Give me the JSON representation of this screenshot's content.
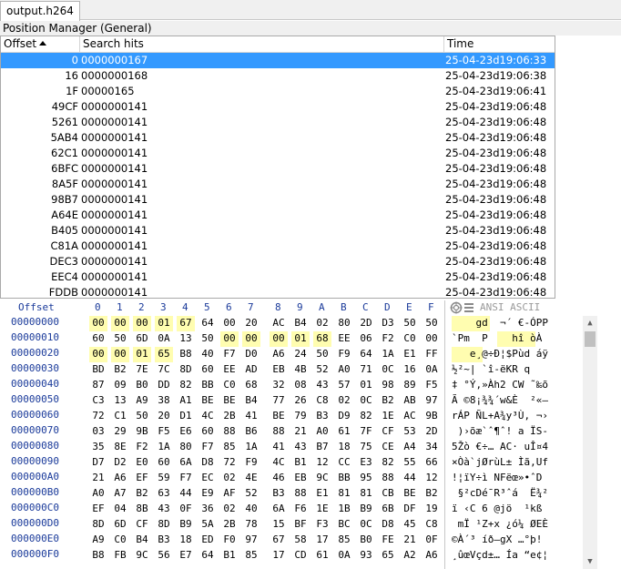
{
  "tab": {
    "label": "output.h264"
  },
  "panel": {
    "title": "Position Manager (General)"
  },
  "list": {
    "columns": {
      "offset": "Offset",
      "hits": "Search hits",
      "time": "Time"
    },
    "rows": [
      {
        "offset": "0",
        "hits": "0000000167",
        "time": "25-04-23d19:06:33",
        "selected": true
      },
      {
        "offset": "16",
        "hits": "0000000168",
        "time": "25-04-23d19:06:38"
      },
      {
        "offset": "1F",
        "hits": "00000165",
        "time": "25-04-23d19:06:41"
      },
      {
        "offset": "49CF",
        "hits": "0000000141",
        "time": "25-04-23d19:06:48"
      },
      {
        "offset": "5261",
        "hits": "0000000141",
        "time": "25-04-23d19:06:48"
      },
      {
        "offset": "5AB4",
        "hits": "0000000141",
        "time": "25-04-23d19:06:48"
      },
      {
        "offset": "62C1",
        "hits": "0000000141",
        "time": "25-04-23d19:06:48"
      },
      {
        "offset": "6BFC",
        "hits": "0000000141",
        "time": "25-04-23d19:06:48"
      },
      {
        "offset": "8A5F",
        "hits": "0000000141",
        "time": "25-04-23d19:06:48"
      },
      {
        "offset": "98B7",
        "hits": "0000000141",
        "time": "25-04-23d19:06:48"
      },
      {
        "offset": "A64E",
        "hits": "0000000141",
        "time": "25-04-23d19:06:48"
      },
      {
        "offset": "B405",
        "hits": "0000000141",
        "time": "25-04-23d19:06:48"
      },
      {
        "offset": "C81A",
        "hits": "0000000141",
        "time": "25-04-23d19:06:48"
      },
      {
        "offset": "DEC3",
        "hits": "0000000141",
        "time": "25-04-23d19:06:48"
      },
      {
        "offset": "EEC4",
        "hits": "0000000141",
        "time": "25-04-23d19:06:48"
      },
      {
        "offset": "FDDB",
        "hits": "0000000141",
        "time": "25-04-23d19:06:48"
      }
    ]
  },
  "hex": {
    "offset_label": "Offset",
    "columns": [
      "0",
      "1",
      "2",
      "3",
      "4",
      "5",
      "6",
      "7",
      "8",
      "9",
      "A",
      "B",
      "C",
      "D",
      "E",
      "F"
    ],
    "ascii_label": "ANSI ASCII",
    "rows": [
      {
        "addr": "00000000",
        "bytes": [
          "00",
          "00",
          "00",
          "01",
          "67",
          "64",
          "00",
          "20",
          "AC",
          "B4",
          "02",
          "80",
          "2D",
          "D3",
          "50",
          "50"
        ],
        "hl": [
          0,
          1,
          2,
          3,
          4
        ],
        "ascii": "    gd  ¬´ €-ÓPP"
      },
      {
        "addr": "00000010",
        "bytes": [
          "60",
          "50",
          "6D",
          "0A",
          "13",
          "50",
          "00",
          "00",
          "00",
          "01",
          "68",
          "EE",
          "06",
          "F2",
          "C0",
          "00"
        ],
        "hl": [
          6,
          7,
          8,
          9,
          10
        ],
        "ascii": "`Pm  P    hî òÀ "
      },
      {
        "addr": "00000020",
        "bytes": [
          "00",
          "00",
          "01",
          "65",
          "B8",
          "40",
          "F7",
          "D0",
          "A6",
          "24",
          "50",
          "F9",
          "64",
          "1A",
          "E1",
          "FF"
        ],
        "hl": [
          0,
          1,
          2,
          3
        ],
        "ascii": "   e¸@÷Ð¦$Pùd áÿ"
      },
      {
        "addr": "00000030",
        "bytes": [
          "BD",
          "B2",
          "7E",
          "7C",
          "8D",
          "60",
          "EE",
          "AD",
          "EB",
          "4B",
          "52",
          "A0",
          "71",
          "0C",
          "16",
          "0A"
        ],
        "hl": [],
        "ascii": "½²~| `î-ëKR q   "
      },
      {
        "addr": "00000040",
        "bytes": [
          "87",
          "09",
          "B0",
          "DD",
          "82",
          "BB",
          "C0",
          "68",
          "32",
          "08",
          "43",
          "57",
          "01",
          "98",
          "89",
          "F5"
        ],
        "hl": [],
        "ascii": "‡ °Ý‚»Àh2 CW ˜‰õ"
      },
      {
        "addr": "00000050",
        "bytes": [
          "C3",
          "13",
          "A9",
          "38",
          "A1",
          "BE",
          "BE",
          "B4",
          "77",
          "26",
          "C8",
          "02",
          "0C",
          "B2",
          "AB",
          "97"
        ],
        "hl": [],
        "ascii": "Ã ©8¡¾¾´w&È  ²«—"
      },
      {
        "addr": "00000060",
        "bytes": [
          "72",
          "C1",
          "50",
          "20",
          "D1",
          "4C",
          "2B",
          "41",
          "BE",
          "79",
          "B3",
          "D9",
          "82",
          "1E",
          "AC",
          "9B"
        ],
        "hl": [],
        "ascii": "rÁP ÑL+A¾y³Ù‚ ¬›"
      },
      {
        "addr": "00000070",
        "bytes": [
          "03",
          "29",
          "9B",
          "F5",
          "E6",
          "60",
          "88",
          "B6",
          "88",
          "21",
          "A0",
          "61",
          "7F",
          "CF",
          "53",
          "2D"
        ],
        "hl": [],
        "ascii": " )›õæ`ˆ¶ˆ! a ÏS-"
      },
      {
        "addr": "00000080",
        "bytes": [
          "35",
          "8E",
          "F2",
          "1A",
          "80",
          "F7",
          "85",
          "1A",
          "41",
          "43",
          "B7",
          "18",
          "75",
          "CE",
          "A4",
          "34"
        ],
        "hl": [],
        "ascii": "5Žò €÷… AC· uÎ¤4"
      },
      {
        "addr": "00000090",
        "bytes": [
          "D7",
          "D2",
          "E0",
          "60",
          "6A",
          "D8",
          "72",
          "F9",
          "4C",
          "B1",
          "12",
          "CC",
          "E3",
          "82",
          "55",
          "66"
        ],
        "hl": [],
        "ascii": "×Òà`jØrùL± Ìã‚Uf"
      },
      {
        "addr": "000000A0",
        "bytes": [
          "21",
          "A6",
          "EF",
          "59",
          "F7",
          "EC",
          "02",
          "4E",
          "46",
          "EB",
          "9C",
          "BB",
          "95",
          "88",
          "44",
          "12"
        ],
        "hl": [],
        "ascii": "!¦ïY÷ì NFëœ»•ˆD "
      },
      {
        "addr": "000000B0",
        "bytes": [
          "A0",
          "A7",
          "B2",
          "63",
          "44",
          "E9",
          "AF",
          "52",
          "B3",
          "88",
          "E1",
          "81",
          "81",
          "CB",
          "BE",
          "B2"
        ],
        "hl": [],
        "ascii": " §²cDé¯R³ˆá  Ë¾²"
      },
      {
        "addr": "000000C0",
        "bytes": [
          "EF",
          "04",
          "8B",
          "43",
          "0F",
          "36",
          "02",
          "40",
          "6A",
          "F6",
          "1E",
          "1B",
          "B9",
          "6B",
          "DF",
          "19"
        ],
        "hl": [],
        "ascii": "ï ‹C 6 @jö  ¹kß "
      },
      {
        "addr": "000000D0",
        "bytes": [
          "8D",
          "6D",
          "CF",
          "8D",
          "B9",
          "5A",
          "2B",
          "78",
          "15",
          "BF",
          "F3",
          "BC",
          "0C",
          "D8",
          "45",
          "C8"
        ],
        "hl": [],
        "ascii": " mÏ ¹Z+x ¿ó¼ ØEÈ"
      },
      {
        "addr": "000000E0",
        "bytes": [
          "A9",
          "C0",
          "B4",
          "B3",
          "18",
          "ED",
          "F0",
          "97",
          "67",
          "58",
          "17",
          "85",
          "B0",
          "FE",
          "21",
          "0F"
        ],
        "hl": [],
        "ascii": "©À´³ íð—gX …°þ! "
      },
      {
        "addr": "000000F0",
        "bytes": [
          "B8",
          "FB",
          "9C",
          "56",
          "E7",
          "64",
          "B1",
          "85",
          "17",
          "CD",
          "61",
          "0A",
          "93",
          "65",
          "A2",
          "A6"
        ],
        "hl": [],
        "ascii": "¸ûœVçd±… Ía “e¢¦"
      }
    ]
  }
}
